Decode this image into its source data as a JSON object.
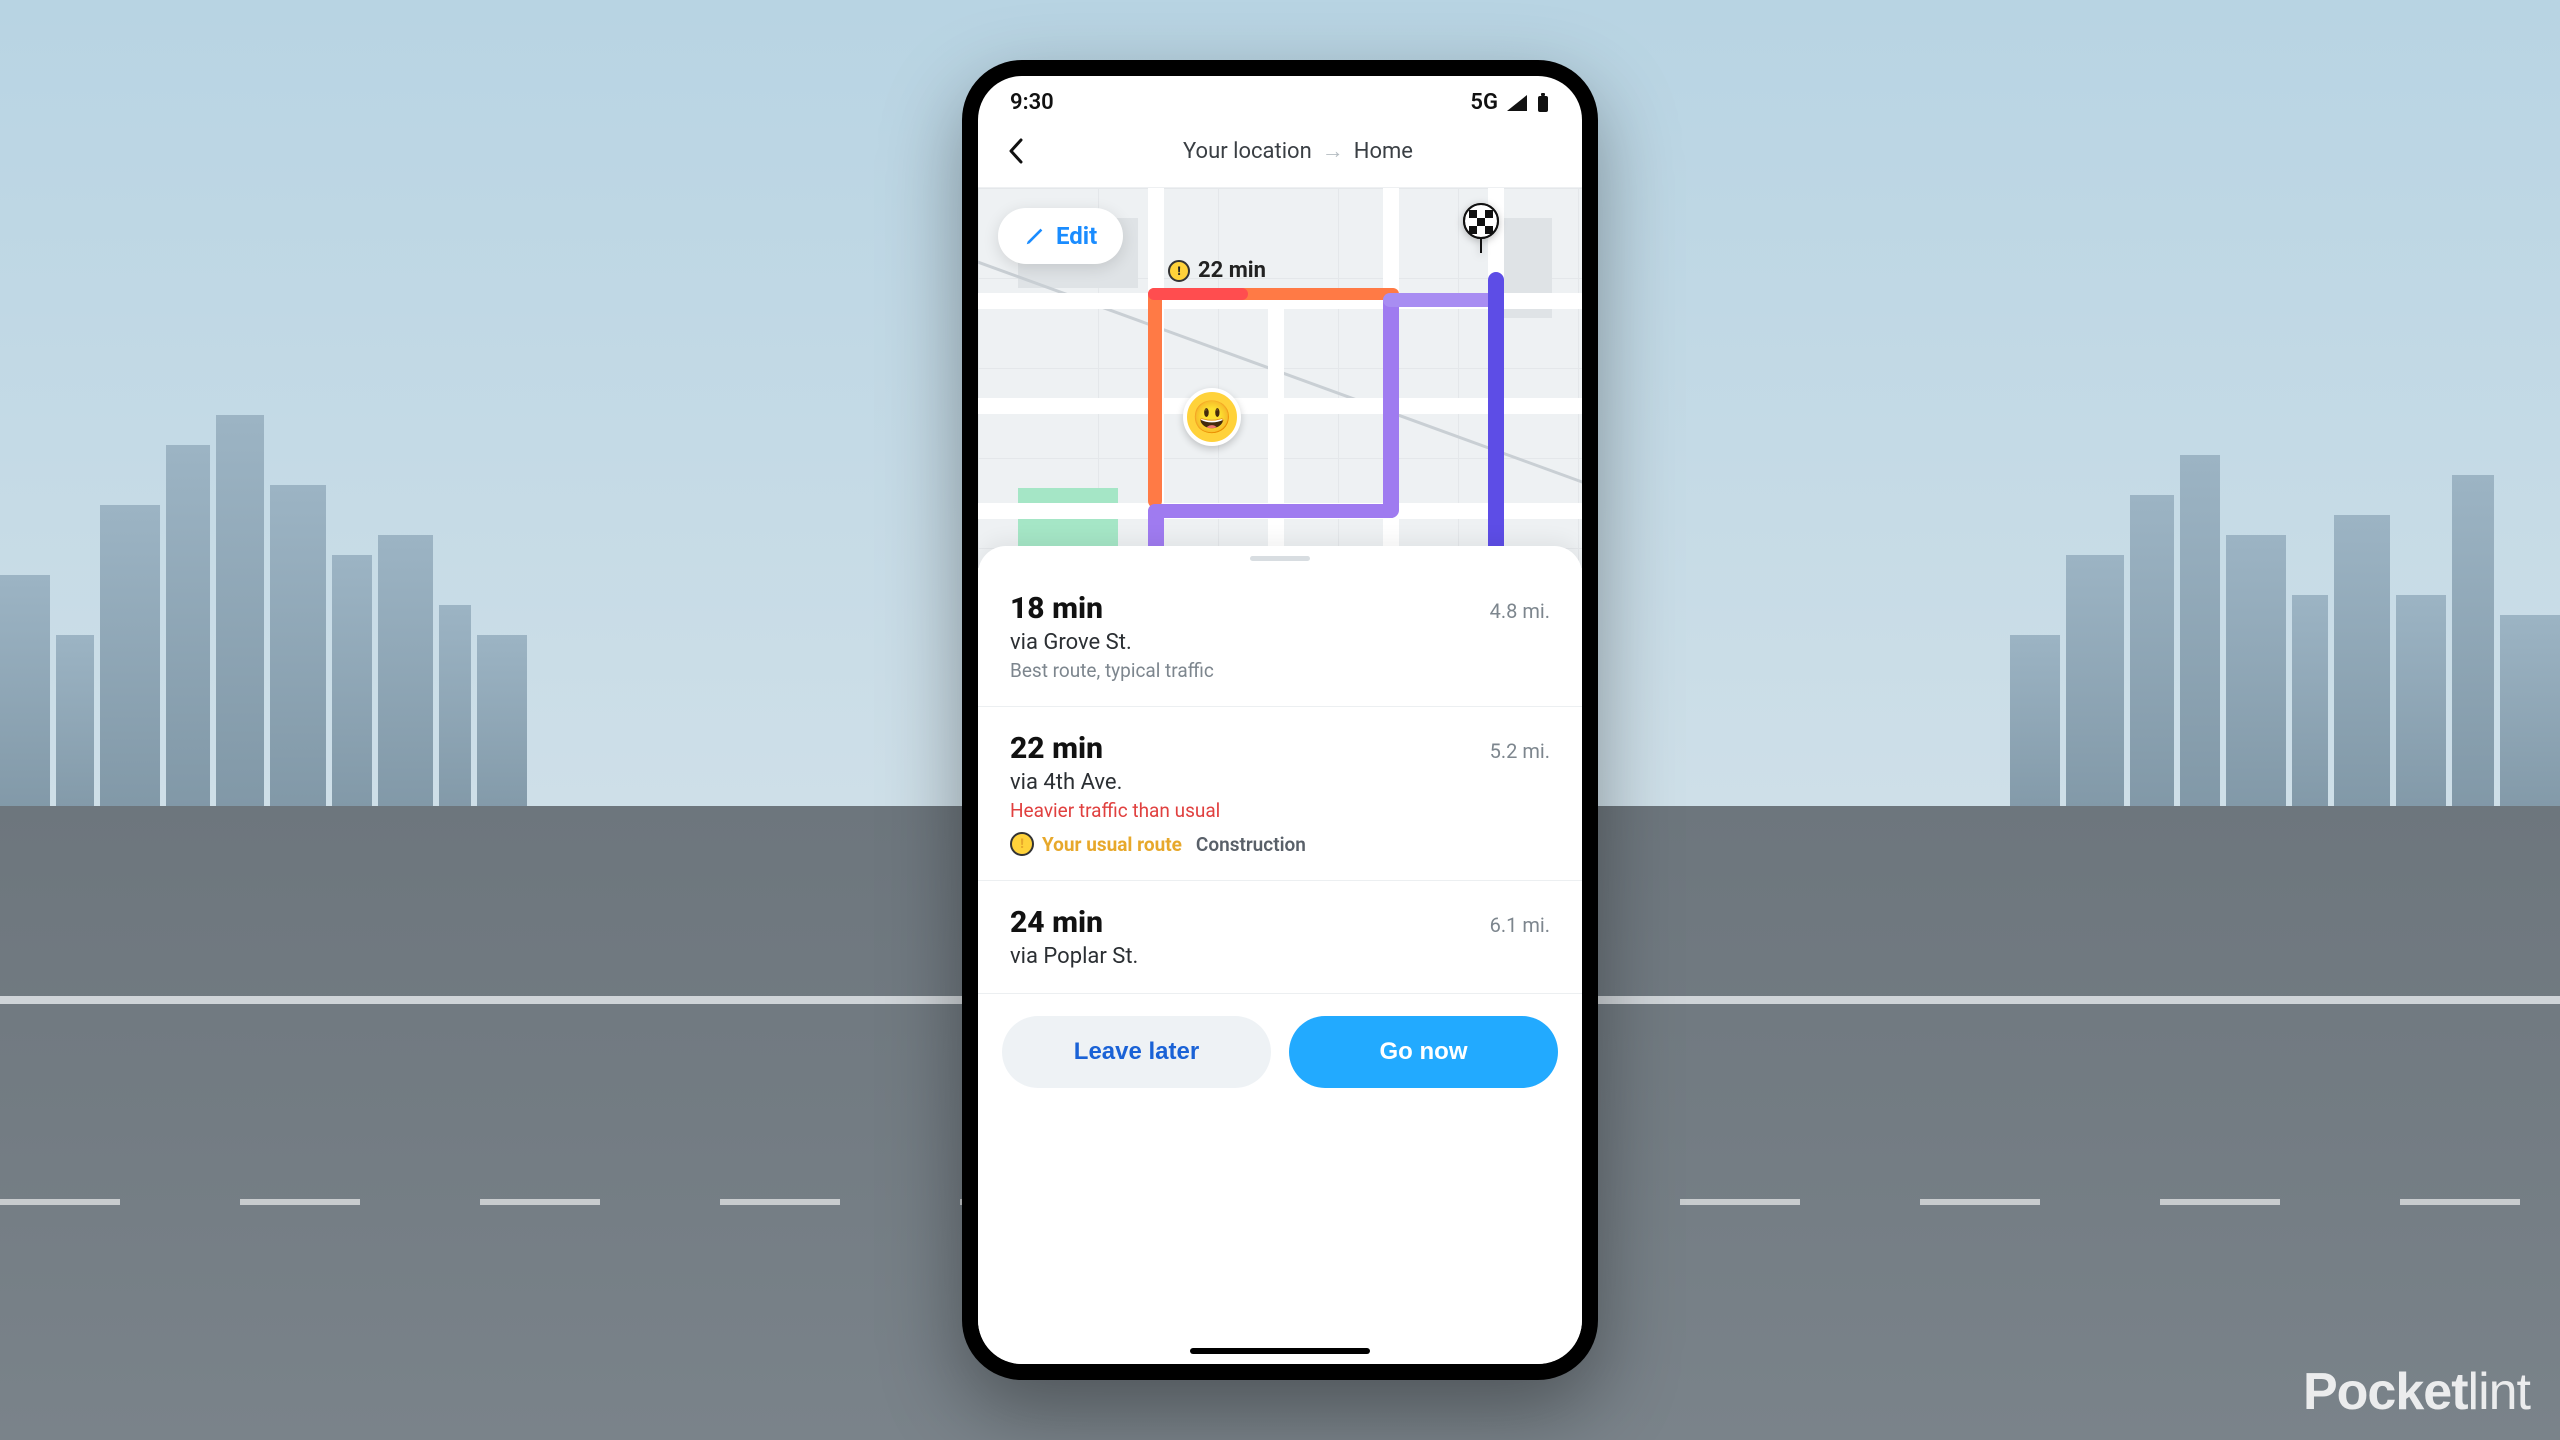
{
  "watermark": {
    "bold": "Pocket",
    "light": "lint"
  },
  "status": {
    "time": "9:30",
    "network": "5G"
  },
  "header": {
    "from": "Your location",
    "to": "Home"
  },
  "map": {
    "edit_label": "Edit",
    "time_badge": "22 min"
  },
  "routes": [
    {
      "time": "18 min",
      "distance": "4.8 mi.",
      "via": "via Grove St.",
      "subtitle": "Best route, typical traffic",
      "warning": null,
      "usual": null,
      "construction": null
    },
    {
      "time": "22 min",
      "distance": "5.2 mi.",
      "via": "via 4th Ave.",
      "subtitle": null,
      "warning": "Heavier traffic than usual",
      "usual": "Your usual route",
      "construction": "Construction"
    },
    {
      "time": "24 min",
      "distance": "6.1 mi.",
      "via": "via Poplar St.",
      "subtitle": null,
      "warning": null,
      "usual": null,
      "construction": null
    }
  ],
  "actions": {
    "leave_later": "Leave later",
    "go_now": "Go now"
  }
}
